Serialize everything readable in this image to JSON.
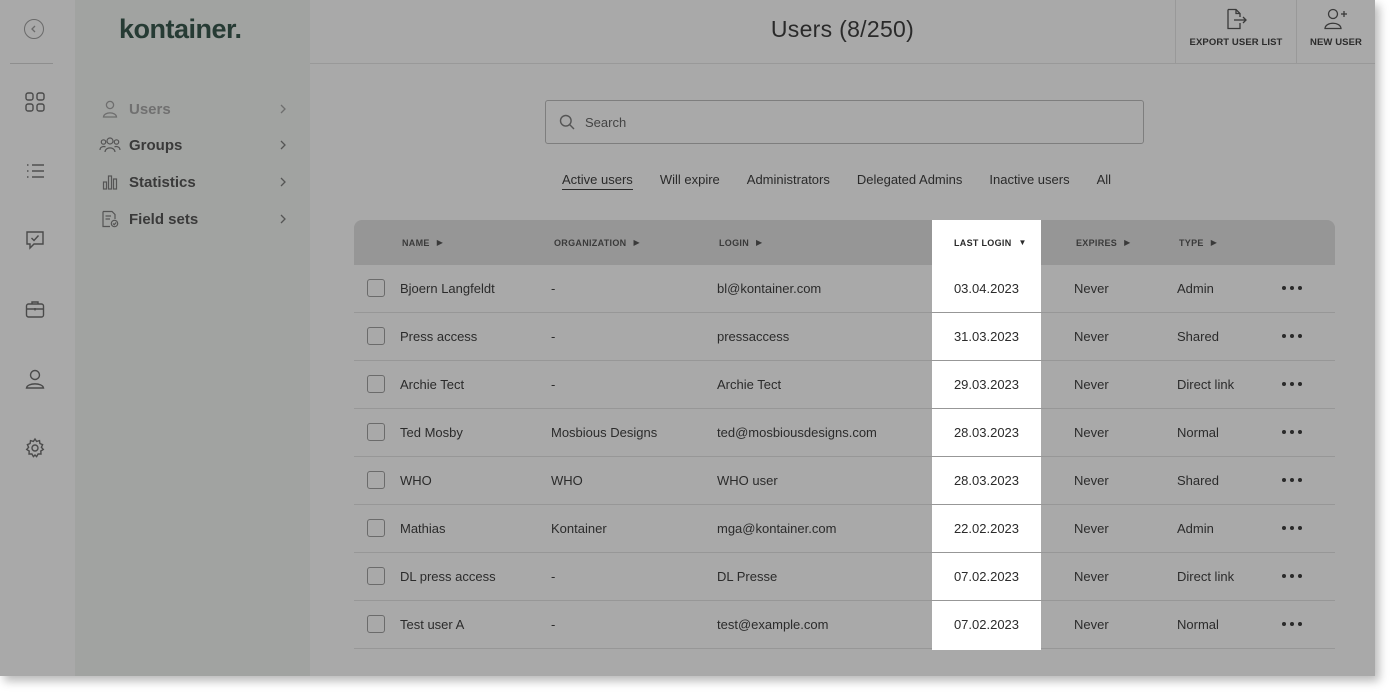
{
  "app": {
    "logo": "kontainer."
  },
  "rail": {
    "icons": [
      "collapse-chevron-icon",
      "grid-icon",
      "list-icon",
      "chat-check-icon",
      "briefcase-icon",
      "person-icon",
      "gear-icon"
    ]
  },
  "sidebar": {
    "items": [
      {
        "label": "Users",
        "icon": "user-icon",
        "active": true
      },
      {
        "label": "Groups",
        "icon": "users-group-icon",
        "active": false
      },
      {
        "label": "Statistics",
        "icon": "bar-chart-icon",
        "active": false
      },
      {
        "label": "Field sets",
        "icon": "field-sets-icon",
        "active": false
      }
    ]
  },
  "header": {
    "title": "Users (8/250)",
    "export_label": "EXPORT USER LIST",
    "new_user_label": "NEW USER"
  },
  "search": {
    "placeholder": "Search"
  },
  "tabs": [
    {
      "label": "Active users",
      "active": true
    },
    {
      "label": "Will expire",
      "active": false
    },
    {
      "label": "Administrators",
      "active": false
    },
    {
      "label": "Delegated Admins",
      "active": false
    },
    {
      "label": "Inactive users",
      "active": false
    },
    {
      "label": "All",
      "active": false
    }
  ],
  "table": {
    "columns": {
      "name": "NAME",
      "organization": "ORGANIZATION",
      "login": "LOGIN",
      "last_login": "LAST LOGIN",
      "expires": "EXPIRES",
      "type": "TYPE"
    },
    "sorted_column": "last_login",
    "rows": [
      {
        "name": "Bjoern Langfeldt",
        "organization": "-",
        "login": "bl@kontainer.com",
        "last_login": "03.04.2023",
        "expires": "Never",
        "type": "Admin"
      },
      {
        "name": "Press access",
        "organization": "-",
        "login": "pressaccess",
        "last_login": "31.03.2023",
        "expires": "Never",
        "type": "Shared"
      },
      {
        "name": "Archie Tect",
        "organization": "-",
        "login": "Archie Tect",
        "last_login": "29.03.2023",
        "expires": "Never",
        "type": "Direct link"
      },
      {
        "name": "Ted Mosby",
        "organization": "Mosbious Designs",
        "login": "ted@mosbiousdesigns.com",
        "last_login": "28.03.2023",
        "expires": "Never",
        "type": "Normal"
      },
      {
        "name": "WHO",
        "organization": "WHO",
        "login": "WHO user",
        "last_login": "28.03.2023",
        "expires": "Never",
        "type": "Shared"
      },
      {
        "name": "Mathias",
        "organization": "Kontainer",
        "login": "mga@kontainer.com",
        "last_login": "22.02.2023",
        "expires": "Never",
        "type": "Admin"
      },
      {
        "name": "DL press access",
        "organization": "-",
        "login": "DL Presse",
        "last_login": "07.02.2023",
        "expires": "Never",
        "type": "Direct link"
      },
      {
        "name": "Test user A",
        "organization": "-",
        "login": "test@example.com",
        "last_login": "07.02.2023",
        "expires": "Never",
        "type": "Normal"
      }
    ]
  },
  "colors": {
    "overlay": "#a9a9a9",
    "sidebar": "#a1a3a1",
    "logo": "#263b34",
    "highlight": "#ffffff"
  }
}
